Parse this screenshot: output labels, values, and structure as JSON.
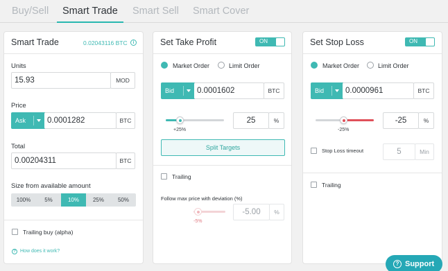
{
  "tabs": [
    {
      "label": "Buy/Sell"
    },
    {
      "label": "Smart Trade"
    },
    {
      "label": "Smart Sell"
    },
    {
      "label": "Smart Cover"
    }
  ],
  "colors": {
    "accent": "#3fb9b3",
    "danger": "#e0505a",
    "support": "#25a8b6"
  },
  "smart_trade": {
    "title": "Smart Trade",
    "balance": "0.02043116 BTC",
    "units_label": "Units",
    "units_value": "15.93",
    "units_button": "MOD",
    "price_label": "Price",
    "price_side": "Ask",
    "price_value": "0.0001282",
    "price_unit": "BTC",
    "total_label": "Total",
    "total_value": "0.00204311",
    "total_unit": "BTC",
    "size_label": "Size from available amount",
    "size_options": [
      "100%",
      "5%",
      "10%",
      "25%",
      "50%"
    ],
    "size_selected": "10%",
    "trailing_buy_label": "Trailing buy (alpha)",
    "help_link": "How does it work?"
  },
  "take_profit": {
    "title": "Set Take Profit",
    "toggle_label": "ON",
    "order_types": [
      "Market Order",
      "Limit Order"
    ],
    "selected_order": "Market Order",
    "side": "Bid",
    "price_value": "0.0001602",
    "price_unit": "BTC",
    "slider_value": "25",
    "slider_unit": "%",
    "slider_tick": "+25%",
    "split_targets_label": "Split Targets",
    "trailing_label": "Trailing",
    "deviation_label": "Follow max price with deviation (%)",
    "deviation_value": "-5.00",
    "deviation_unit": "%",
    "deviation_tick": "-5%"
  },
  "stop_loss": {
    "title": "Set Stop Loss",
    "toggle_label": "ON",
    "order_types": [
      "Market Order",
      "Limit Order"
    ],
    "selected_order": "Market Order",
    "side": "Bid",
    "price_value": "0.0000961",
    "price_unit": "BTC",
    "slider_value": "-25",
    "slider_unit": "%",
    "slider_tick": "-25%",
    "timeout_label": "Stop Loss timeout",
    "timeout_value": "5",
    "timeout_unit": "Min",
    "trailing_label": "Trailing"
  },
  "support": {
    "label": "Support",
    "icon": "question-icon"
  }
}
